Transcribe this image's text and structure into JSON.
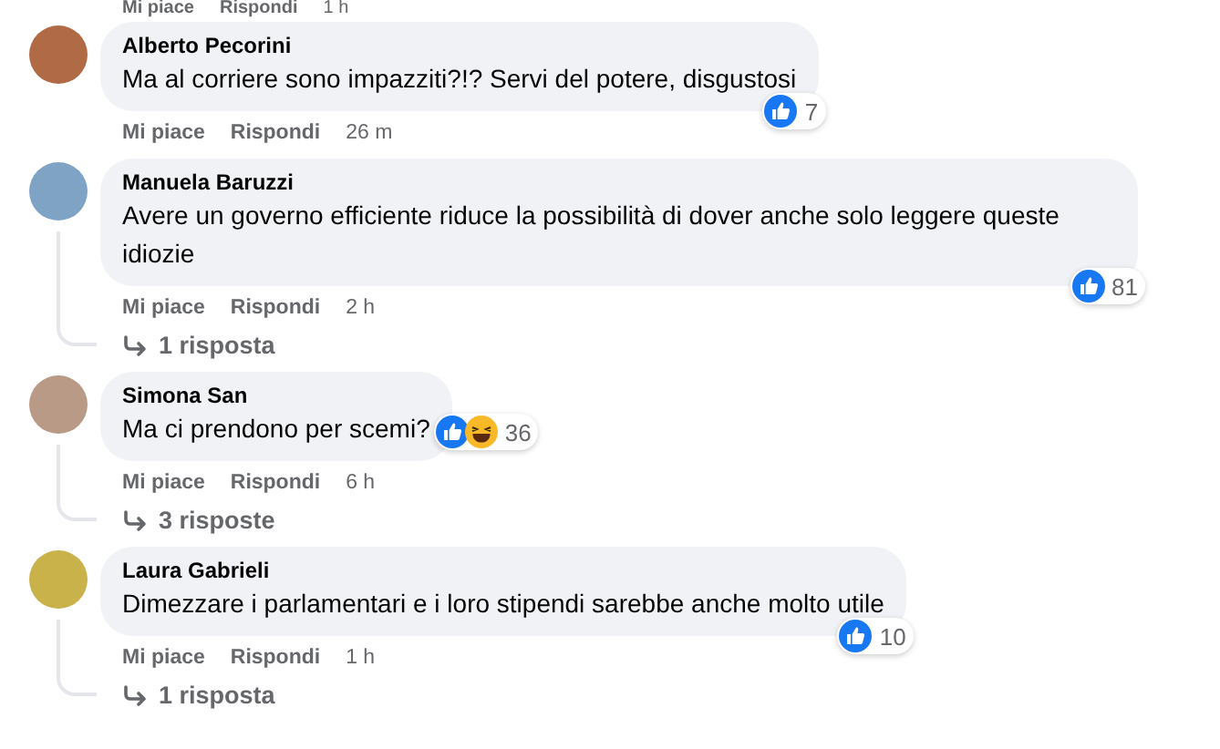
{
  "top_actions": {
    "like": "Mi piace",
    "reply": "Rispondi",
    "time": "1 h"
  },
  "comments": [
    {
      "author": "Alberto Pecorini",
      "text": "Ma al corriere sono impazziti?!? Servi del potere, disgustosi",
      "reactions": [
        {
          "kind": "like"
        }
      ],
      "reaction_count": "7",
      "badge_outside": false,
      "like": "Mi piace",
      "reply": "Rispondi",
      "time": "26 m"
    },
    {
      "author": "Manuela Baruzzi",
      "text": "Avere un governo efficiente riduce la possibilità di dover anche solo leggere queste idiozie",
      "reactions": [
        {
          "kind": "like"
        }
      ],
      "reaction_count": "81",
      "badge_outside": false,
      "like": "Mi piace",
      "reply": "Rispondi",
      "time": "2 h",
      "replies": "1 risposta"
    },
    {
      "author": "Simona San",
      "text": "Ma ci prendono per scemi?",
      "reactions": [
        {
          "kind": "like"
        },
        {
          "kind": "haha"
        }
      ],
      "reaction_count": "36",
      "badge_outside": true,
      "like": "Mi piace",
      "reply": "Rispondi",
      "time": "6 h",
      "replies": "3 risposte"
    },
    {
      "author": "Laura Gabrieli",
      "text": "Dimezzare i parlamentari e i loro stipendi sarebbe anche molto utile",
      "reactions": [
        {
          "kind": "like"
        }
      ],
      "reaction_count": "10",
      "badge_outside": false,
      "like": "Mi piace",
      "reply": "Rispondi",
      "time": "1 h",
      "replies": "1 risposta"
    }
  ]
}
